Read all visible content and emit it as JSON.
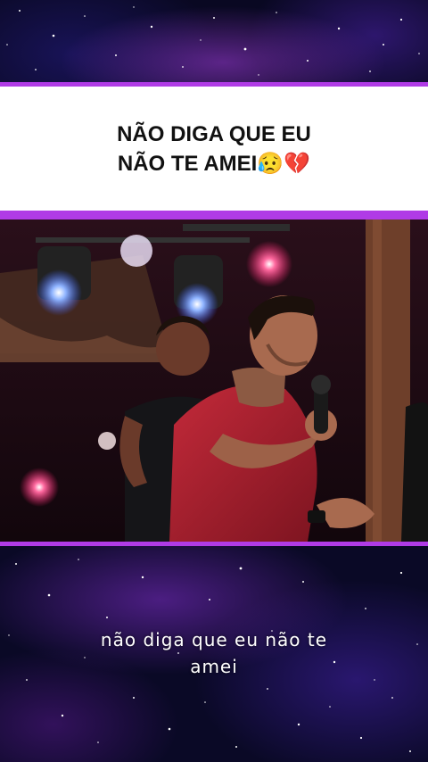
{
  "title": {
    "line1": "NÃO DIGA QUE EU",
    "line2_text": "NÃO TE AMEI",
    "line2_emojis": "😥💔"
  },
  "subtitle": {
    "line1": "não diga que eu não te",
    "line2": "amei"
  },
  "colors": {
    "accent_bar": "#b03be6",
    "panel_bg": "#ffffff",
    "title_text": "#111111",
    "subtitle_text": "#ffffff"
  },
  "video": {
    "content": "concert-performance-frame"
  }
}
